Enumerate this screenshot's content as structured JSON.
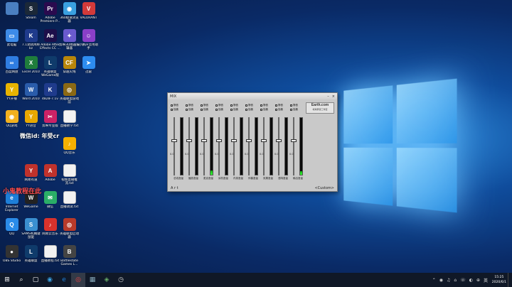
{
  "desktop": {
    "icons": [
      {
        "label": "",
        "col": 0,
        "row": 0,
        "color": "#4a7fc1",
        "glyph": ""
      },
      {
        "label": "Steam",
        "col": 1,
        "row": 0,
        "color": "#1b2838",
        "glyph": "S"
      },
      {
        "label": "Adobe Premiere P...",
        "col": 2,
        "row": 0,
        "color": "#2a0a4e",
        "glyph": "Pr"
      },
      {
        "label": "360极速浏览器",
        "col": 3,
        "row": 0,
        "color": "#3aa0e0",
        "glyph": "◉"
      },
      {
        "label": "VALORANT",
        "col": 4,
        "row": 0,
        "color": "#d23a3a",
        "glyph": "V"
      },
      {
        "label": "此电脑",
        "col": 0,
        "row": 1,
        "color": "#3d8be8",
        "glyph": "▭"
      },
      {
        "label": "7.1调试简称kz",
        "col": 1,
        "row": 1,
        "color": "#1f3b8c",
        "glyph": "K"
      },
      {
        "label": "Adobe After Effects CC ...",
        "col": 2,
        "row": 1,
        "color": "#1d0f4a",
        "glyph": "Ae"
      },
      {
        "label": "剪映3D图画编辑器",
        "col": 3,
        "row": 1,
        "color": "#6a5acd",
        "glyph": "✦"
      },
      {
        "label": "小鹏声音用助手",
        "col": 4,
        "row": 1,
        "color": "#8a3fc8",
        "glyph": "☺"
      },
      {
        "label": "百度网盘",
        "col": 0,
        "row": 2,
        "color": "#2f7de1",
        "glyph": "∞"
      },
      {
        "label": "Excel 2010",
        "col": 1,
        "row": 2,
        "color": "#1f7d3c",
        "glyph": "X"
      },
      {
        "label": "英雄联盟WeGame版",
        "col": 2,
        "row": 2,
        "color": "#0f3b6b",
        "glyph": "L"
      },
      {
        "label": "穿越火线",
        "col": 3,
        "row": 2,
        "color": "#b8860b",
        "glyph": "CF"
      },
      {
        "label": "迅雷",
        "col": 4,
        "row": 2,
        "color": "#2d8cf0",
        "glyph": "➤"
      },
      {
        "label": "YY开播",
        "col": 0,
        "row": 3,
        "color": "#e8b400",
        "glyph": "Y"
      },
      {
        "label": "Word 2010",
        "col": 1,
        "row": 3,
        "color": "#2a5caa",
        "glyph": "W"
      },
      {
        "label": "4828-7.1v",
        "col": 2,
        "row": 3,
        "color": "#1f3b8c",
        "glyph": "K"
      },
      {
        "label": "英雄联盟游戏前",
        "col": 3,
        "row": 3,
        "color": "#8b6914",
        "glyph": "◎"
      },
      {
        "label": "QQ游戏",
        "col": 0,
        "row": 4,
        "color": "#f2b01e",
        "glyph": "◉"
      },
      {
        "label": "YY语音",
        "col": 1,
        "row": 4,
        "color": "#e8a800",
        "glyph": "Y"
      },
      {
        "label": "剪映专业版",
        "col": 2,
        "row": 4,
        "color": "#cc2266",
        "glyph": "✂"
      },
      {
        "label": "直播教学.txt",
        "col": 3,
        "row": 4,
        "color": "#f2f2f2",
        "glyph": ""
      },
      {
        "label": "QQ音乐",
        "col": 3,
        "row": 5,
        "color": "#f5b000",
        "glyph": "♪"
      },
      {
        "label": "网易有道",
        "col": 1,
        "row": 6,
        "color": "#c0322c",
        "glyph": "Y"
      },
      {
        "label": "Adobe",
        "col": 2,
        "row": 6,
        "color": "#c0322c",
        "glyph": "A"
      },
      {
        "label": "视频直播推流.txt",
        "col": 3,
        "row": 6,
        "color": "#f2f2f2",
        "glyph": ""
      },
      {
        "label": "Internet Explorer",
        "col": 0,
        "row": 7,
        "color": "#1e7fd8",
        "glyph": "e"
      },
      {
        "label": "WeGame",
        "col": 1,
        "row": 7,
        "color": "#222",
        "glyph": "W"
      },
      {
        "label": "微信",
        "col": 2,
        "row": 7,
        "color": "#2aae67",
        "glyph": "✉"
      },
      {
        "label": "直播调试.txt",
        "col": 3,
        "row": 7,
        "color": "#f2f2f2",
        "glyph": ""
      },
      {
        "label": "QQ",
        "col": 0,
        "row": 8,
        "color": "#2a8be8",
        "glyph": "Q"
      },
      {
        "label": "SAMS机械键鼠驱",
        "col": 1,
        "row": 8,
        "color": "#3a8fd0",
        "glyph": "S"
      },
      {
        "label": "网易云音乐",
        "col": 2,
        "row": 8,
        "color": "#d8322c",
        "glyph": "♪"
      },
      {
        "label": "英雄联盟启动器",
        "col": 3,
        "row": 8,
        "color": "#b83a2a",
        "glyph": "◎"
      },
      {
        "label": "OBS Studio",
        "col": 0,
        "row": 9,
        "color": "#333",
        "glyph": "●"
      },
      {
        "label": "英雄联盟",
        "col": 1,
        "row": 9,
        "color": "#0f3b6b",
        "glyph": "L"
      },
      {
        "label": "直播教程.txt",
        "col": 2,
        "row": 9,
        "color": "#f2f2f2",
        "glyph": ""
      },
      {
        "label": "Battlestate Games L...",
        "col": 3,
        "row": 9,
        "color": "#444",
        "glyph": "B"
      }
    ],
    "overlay": {
      "line1": "微信id: 年受cr",
      "line2": "小鬼教程在此"
    }
  },
  "mixer": {
    "title": "MIX",
    "min_symbol": "–",
    "close_symbol": "×",
    "logo_main": "Earth.com",
    "logo_sub": "地球录音工作室",
    "footer_left": "A  r  t",
    "footer_right": "<Custom>",
    "check_labels": [
      "静音",
      "独奏"
    ],
    "strips": [
      {
        "name": "总线音量",
        "db": "0.0",
        "level": 0.0,
        "fader": 0.62
      },
      {
        "name": "播放音量",
        "db": "0.0",
        "level": 0.0,
        "fader": 0.62
      },
      {
        "name": "麦克音量",
        "db": "0.0",
        "level": 0.08,
        "fader": 0.62
      },
      {
        "name": "耳机音量",
        "db": "0.0",
        "level": 0.0,
        "fader": 0.62
      },
      {
        "name": "内录音量",
        "db": "0.0",
        "level": 0.0,
        "fader": 0.62
      },
      {
        "name": "伴奏音量",
        "db": "0.0",
        "level": 0.0,
        "fader": 0.62
      },
      {
        "name": "效果音量",
        "db": "0.0",
        "level": 0.0,
        "fader": 0.62
      },
      {
        "name": "混响音量",
        "db": "0.0",
        "level": 0.0,
        "fader": 0.62
      },
      {
        "name": "输出音量",
        "db": "0.0",
        "level": 0.06,
        "fader": 0.62
      }
    ]
  },
  "taskbar": {
    "start": "⊞",
    "search": "⌕",
    "taskview": "▢",
    "apps": [
      {
        "glyph": "◉",
        "color": "#3aa0e0",
        "active": false
      },
      {
        "glyph": "e",
        "color": "#1e7fd8",
        "active": false
      },
      {
        "glyph": "◎",
        "color": "#e44",
        "active": true
      },
      {
        "glyph": "▦",
        "color": "#8ab",
        "active": false
      },
      {
        "glyph": "◈",
        "color": "#6a6",
        "active": false
      },
      {
        "glyph": "◷",
        "color": "#ccc",
        "active": false
      }
    ],
    "tray_icons": [
      "⌃",
      "◉",
      "♫",
      "⌂",
      "☏",
      "◐",
      "⊕",
      "英"
    ],
    "time": "15:25",
    "date": "2020/6/1"
  }
}
